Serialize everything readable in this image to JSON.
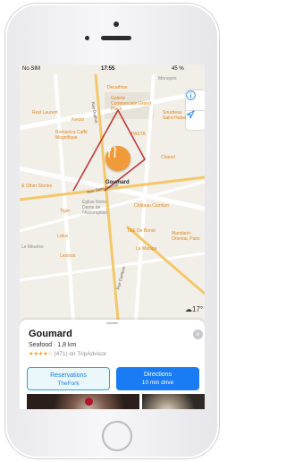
{
  "status_bar": {
    "carrier": "No SIM",
    "time": "17:55",
    "battery": "45 %"
  },
  "map": {
    "pois": [
      "Decathlon",
      "Galerie Commerciale Grand Place",
      "Sourdeau Saint-Hubert",
      "Monoprix",
      "Rest Laurent",
      "Kenzo",
      "Romanica Caffè Magnifique",
      "PASTA",
      "Chanel",
      "& Other Stories",
      "Goumard",
      "Eglise Notre-Dame de l'Assomption",
      "Château Cambon",
      "Tiger",
      "T&E De Bondi",
      "Mandarin Oriental, Paris",
      "La Mauiga",
      "Le Meurice",
      "Lotus",
      "Lesmos"
    ],
    "streets": [
      "Rue Saint-Honoré",
      "Rue Cambon",
      "Rue Duphot"
    ],
    "pin_label": "Goumard",
    "weather": "17°"
  },
  "controls": {
    "info_icon": "info-icon",
    "location_icon": "location-arrow-icon"
  },
  "card": {
    "name": "Goumard",
    "subtitle": "Seafood · 1,8 km",
    "stars": "★★★★☆",
    "rating_text": "(471) on TripAdvisor",
    "buttons": {
      "reservations_label": "Reservations",
      "reservations_sub": "TheFork",
      "directions_label": "Directions",
      "directions_sub": "10 min drive"
    }
  },
  "colors": {
    "accent": "#1a7cf5",
    "pin": "#f19a3a",
    "route": "#c23a3a"
  }
}
